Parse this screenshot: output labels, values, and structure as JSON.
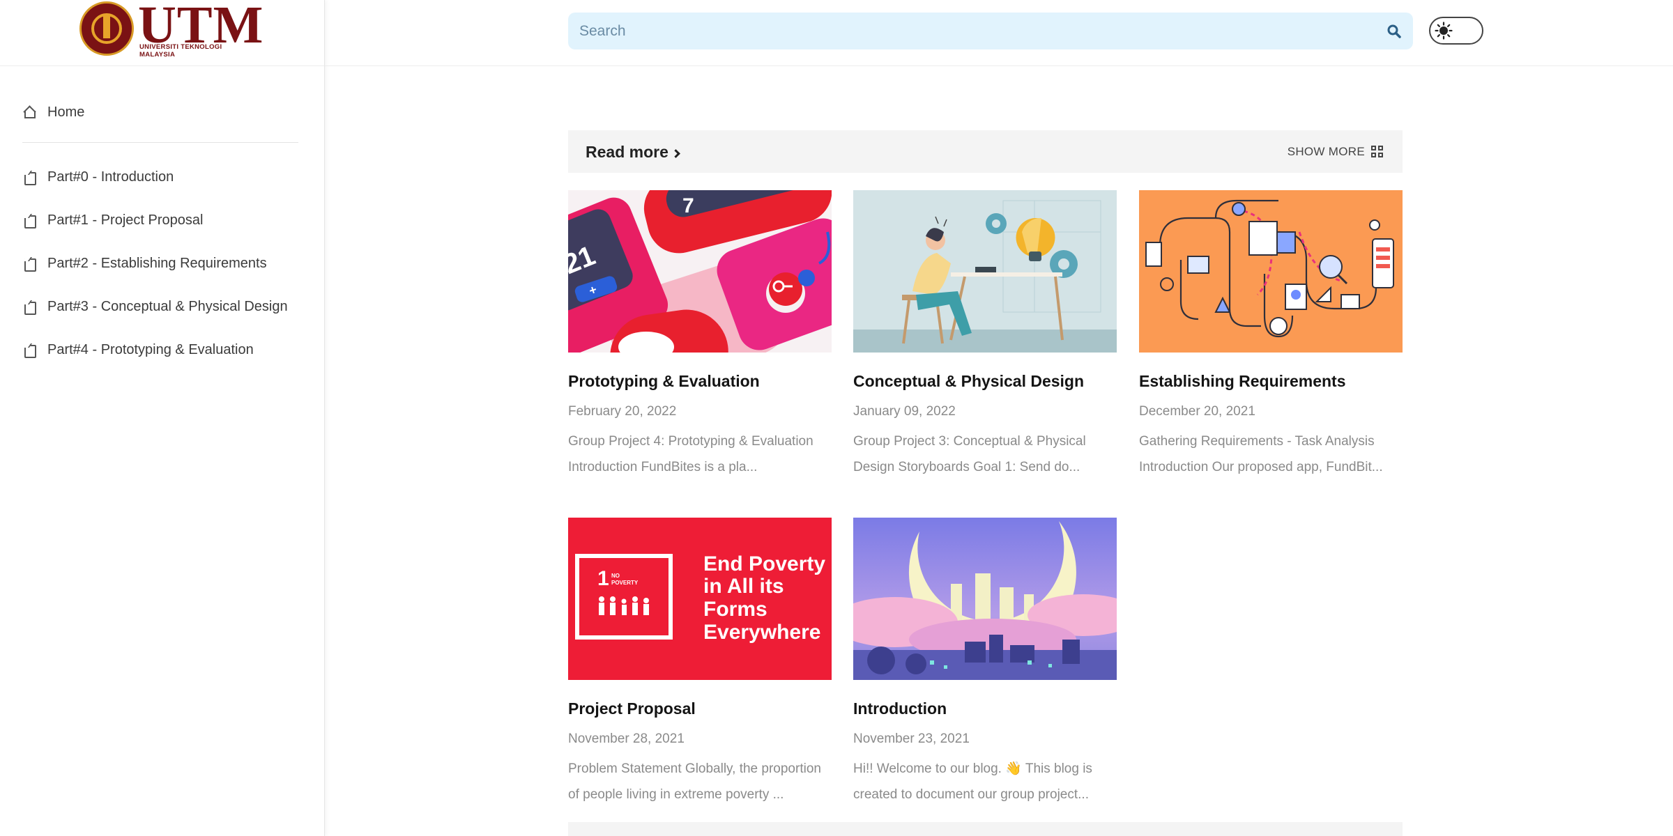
{
  "brand": {
    "logo_text": "UTM",
    "logo_subtext": "UNIVERSITI TEKNOLOGI MALAYSIA",
    "colors": {
      "maroon": "#7a1214",
      "gold": "#e7a42a"
    }
  },
  "sidebar": {
    "items": [
      {
        "label": "Home",
        "icon": "home-icon"
      },
      {
        "label": "Part#0 - Introduction",
        "icon": "page-icon"
      },
      {
        "label": "Part#1 - Project Proposal",
        "icon": "page-icon"
      },
      {
        "label": "Part#2 - Establishing Requirements",
        "icon": "page-icon"
      },
      {
        "label": "Part#3 - Conceptual & Physical Design",
        "icon": "page-icon"
      },
      {
        "label": "Part#4 - Prototyping & Evaluation",
        "icon": "page-icon"
      }
    ]
  },
  "header": {
    "search_placeholder": "Search",
    "search_icon": "search-icon",
    "theme_toggle_icon": "sun-icon",
    "search_bg": "#e1f3fd"
  },
  "section": {
    "title": "Read more",
    "show_more": "SHOW MORE"
  },
  "posts": [
    {
      "title": "Prototyping & Evaluation",
      "date": "February 20, 2022",
      "excerpt_l1": "Group Project 4: Prototyping & Evaluation",
      "excerpt_l2": "Introduction FundBites is a pla..."
    },
    {
      "title": "Conceptual & Physical Design",
      "date": "January 09, 2022",
      "excerpt_l1": "Group Project 3: Conceptual & Physical",
      "excerpt_l2": "Design Storyboards Goal 1: Send do..."
    },
    {
      "title": "Establishing Requirements",
      "date": "December 20, 2021",
      "excerpt_l1": "Gathering Requirements - Task Analysis",
      "excerpt_l2": "Introduction Our proposed app, FundBit..."
    },
    {
      "title": "Project Proposal",
      "date": "November 28, 2021",
      "excerpt_l1": "Problem Statement Globally, the proportion",
      "excerpt_l2": "of people living in extreme poverty ...",
      "thumb_text": {
        "badge_num": "1",
        "badge_l1": "NO",
        "badge_l2": "POVERTY",
        "l1": "End Poverty",
        "l2": "in All its",
        "l3": "Forms",
        "l4": "Everywhere"
      }
    },
    {
      "title": "Introduction",
      "date": "November 23, 2021",
      "excerpt_l1": "Hi!! Welcome to our blog. 👋 This blog is",
      "excerpt_l2": "created to document our group project..."
    }
  ],
  "thumb_calc": {
    "k1": "7",
    "k2": "21",
    "k3": "+"
  }
}
